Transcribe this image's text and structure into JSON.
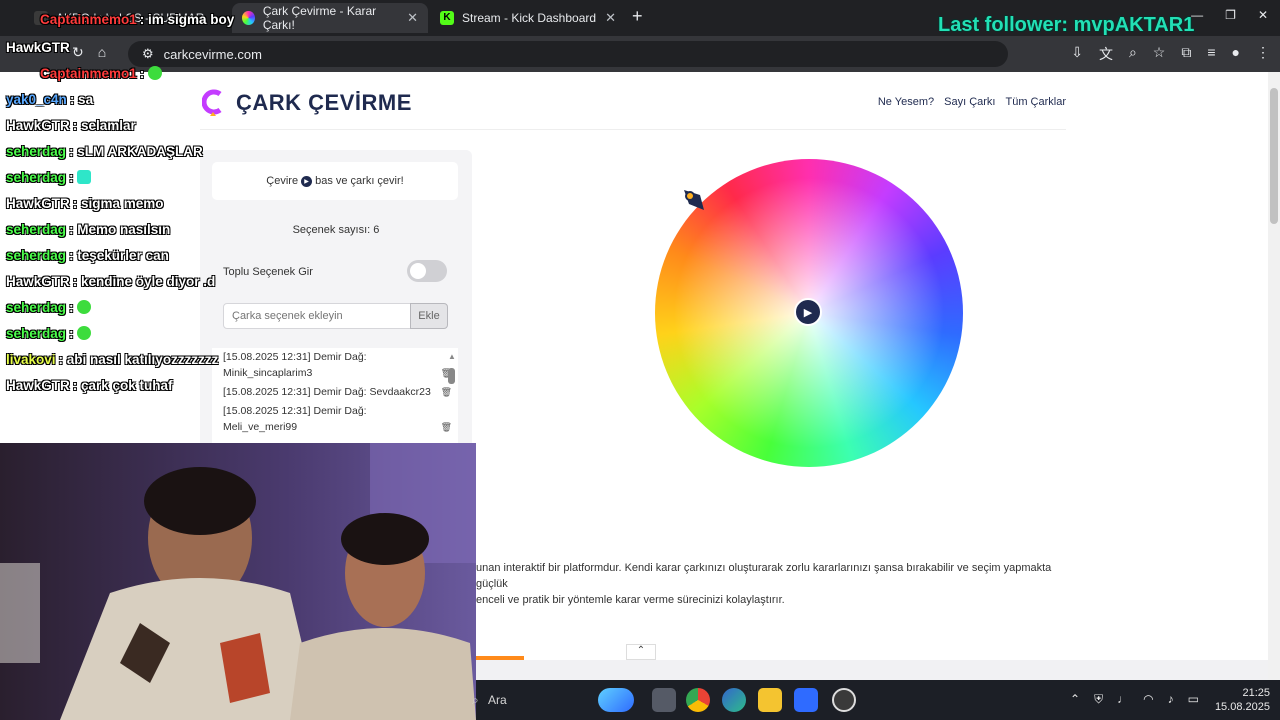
{
  "browser": {
    "tabs": [
      {
        "label": "AKRO | vbel CS - SURMAR"
      },
      {
        "label": "Çark Çevirme - Karar Çarkı!",
        "active": true
      },
      {
        "label": "Stream - Kick Dashboard"
      }
    ],
    "url": "carkcevirme.com"
  },
  "site": {
    "logo_text": "ÇARK ÇEVİRME",
    "nav": [
      "Ne Yesem?",
      "Sayı Çarkı",
      "Tüm Çarklar"
    ],
    "spin_hint_before": "Çevire",
    "spin_hint_after": "bas ve çarkı çevir!",
    "option_count": "Seçenek sayısı: 6",
    "bulk_label": "Toplu Seçenek Gir",
    "input_placeholder": "Çarka seçenek ekleyin",
    "add_button": "Ekle",
    "options": [
      "[15.08.2025 12:31] Demir Dağ: Minik_sincaplarim3",
      "[15.08.2025 12:31] Demir Dağ: Sevdaakcr23",
      "[15.08.2025 12:31] Demir Dağ: Meli_ve_meri99"
    ],
    "desc_line1": "unan interaktif bir platformdur. Kendi karar çarkınızı oluşturarak zorlu kararlarınızı şansa bırakabilir ve seçim yapmakta güçlük",
    "desc_line2": "enceli ve pratik bir yöntemle karar verme sürecinizi kolaylaştırır."
  },
  "overlay": {
    "last_follower": "Last follower: mvpAKTAR1",
    "top_messages": [
      {
        "user": "Captainmemo1",
        "text": ": im sigma boy",
        "color": "#ff3b3b"
      },
      {
        "user": "HawkGTR",
        "text": "",
        "color": "#ffffff"
      },
      {
        "user": "Captainmemo1",
        "text": ":",
        "color": "#ff3b3b"
      }
    ],
    "messages": [
      {
        "user": "yak0_c4n",
        "text": ": sa",
        "color": "#5aa9ff"
      },
      {
        "user": "HawkGTR",
        "text": ": selamlar",
        "color": "#ffffff"
      },
      {
        "user": "seherdag",
        "text": ": sLM ARKADAŞLAR",
        "color": "#4cff4c"
      },
      {
        "user": "seherdag",
        "text": ":",
        "color": "#4cff4c"
      },
      {
        "user": "HawkGTR",
        "text": ": sigma memo",
        "color": "#ffffff"
      },
      {
        "user": "seherdag",
        "text": ": Memo nasılsın",
        "color": "#4cff4c"
      },
      {
        "user": "seherdag",
        "text": ": teşekürler can",
        "color": "#4cff4c"
      },
      {
        "user": "HawkGTR",
        "text": ": kendine öyle diyor .d",
        "color": "#ffffff"
      },
      {
        "user": "seherdag",
        "text": ":",
        "color": "#4cff4c"
      },
      {
        "user": "seherdag",
        "text": ":",
        "color": "#4cff4c"
      },
      {
        "user": "livakovi",
        "text": ": abi nasıl katılıyozzzzzzz",
        "color": "#e8ff4a"
      },
      {
        "user": "HawkGTR",
        "text": ": çark çok tuhaf",
        "color": "#ffffff"
      }
    ]
  },
  "taskbar": {
    "search_label": "Ara",
    "time": "21:25",
    "date": "15.08.2025"
  }
}
